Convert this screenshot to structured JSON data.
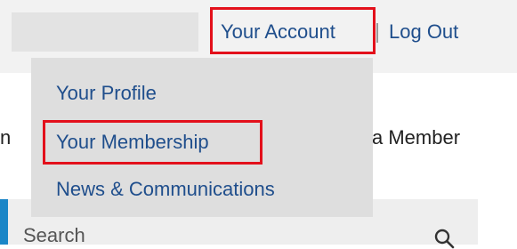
{
  "header": {
    "account_label": "Your Account",
    "logout_label": "Log Out"
  },
  "account_menu": {
    "items": [
      {
        "label": "Your Profile"
      },
      {
        "label": "Your Membership"
      },
      {
        "label": "News & Communications"
      }
    ]
  },
  "background": {
    "left_fragment": "n",
    "right_fragment": "a Member"
  },
  "search": {
    "placeholder": "Search",
    "icon": "search-icon"
  },
  "colors": {
    "link": "#1f4e8c",
    "highlight": "#e3101b",
    "accent": "#1b86c7"
  }
}
